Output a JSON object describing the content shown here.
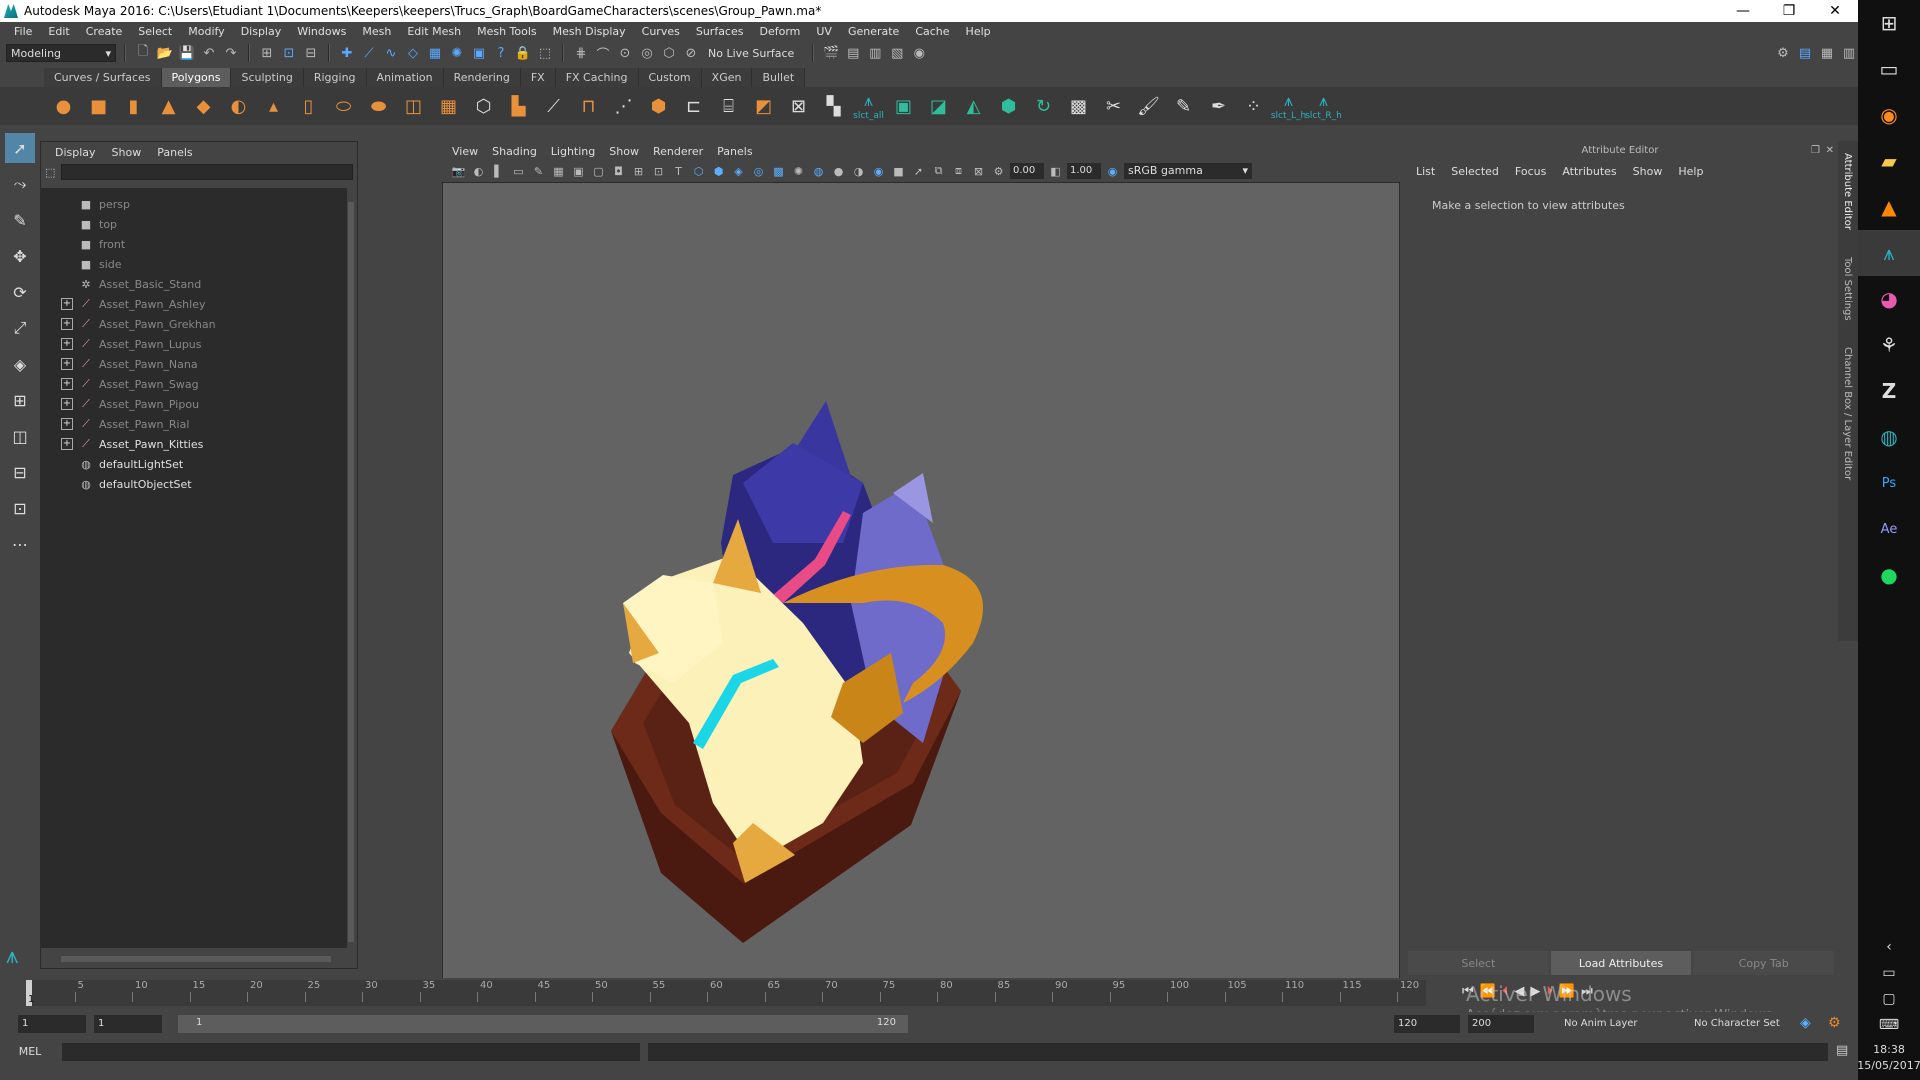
{
  "window": {
    "title": "Autodesk Maya 2016: C:\\Users\\Etudiant 1\\Documents\\Keepers\\keepers\\Trucs_Graph\\BoardGameCharacters\\scenes\\Group_Pawn.ma*",
    "minimize": "—",
    "restore": "❐",
    "close": "✕"
  },
  "menubar": [
    "File",
    "Edit",
    "Create",
    "Select",
    "Modify",
    "Display",
    "Windows",
    "Mesh",
    "Edit Mesh",
    "Mesh Tools",
    "Mesh Display",
    "Curves",
    "Surfaces",
    "Deform",
    "UV",
    "Generate",
    "Cache",
    "Help"
  ],
  "statusline": {
    "mode": "Modeling",
    "live_surface": "No Live Surface"
  },
  "shelf": {
    "tabs": [
      "Curves / Surfaces",
      "Polygons",
      "Sculpting",
      "Rigging",
      "Animation",
      "Rendering",
      "FX",
      "FX Caching",
      "Custom",
      "XGen",
      "Bullet"
    ],
    "active_tab": "Polygons",
    "custom_labels": [
      "slct_all",
      "slct_L_h",
      "slct_R_h"
    ]
  },
  "outliner": {
    "menu": [
      "Display",
      "Show",
      "Panels"
    ],
    "items": [
      {
        "label": "persp",
        "icon": "camera-icon",
        "expandable": false,
        "dim": true
      },
      {
        "label": "top",
        "icon": "camera-icon",
        "expandable": false,
        "dim": true
      },
      {
        "label": "front",
        "icon": "camera-icon",
        "expandable": false,
        "dim": true
      },
      {
        "label": "side",
        "icon": "camera-icon",
        "expandable": false,
        "dim": true
      },
      {
        "label": "Asset_Basic_Stand",
        "icon": "group-icon",
        "expandable": false,
        "dim": true
      },
      {
        "label": "Asset_Pawn_Ashley",
        "icon": "mesh-icon",
        "expandable": true,
        "dim": true
      },
      {
        "label": "Asset_Pawn_Grekhan",
        "icon": "mesh-icon",
        "expandable": true,
        "dim": true
      },
      {
        "label": "Asset_Pawn_Lupus",
        "icon": "mesh-icon",
        "expandable": true,
        "dim": true
      },
      {
        "label": "Asset_Pawn_Nana",
        "icon": "mesh-icon",
        "expandable": true,
        "dim": true
      },
      {
        "label": "Asset_Pawn_Swag",
        "icon": "mesh-icon",
        "expandable": true,
        "dim": true
      },
      {
        "label": "Asset_Pawn_Pipou",
        "icon": "mesh-icon",
        "expandable": true,
        "dim": true
      },
      {
        "label": "Asset_Pawn_Rial",
        "icon": "mesh-icon",
        "expandable": true,
        "dim": true
      },
      {
        "label": "Asset_Pawn_Kitties",
        "icon": "mesh-icon",
        "expandable": true,
        "dim": false
      },
      {
        "label": "defaultLightSet",
        "icon": "set-icon",
        "expandable": false,
        "dim": false
      },
      {
        "label": "defaultObjectSet",
        "icon": "set-icon",
        "expandable": false,
        "dim": false
      }
    ]
  },
  "viewport": {
    "menu": [
      "View",
      "Shading",
      "Lighting",
      "Show",
      "Renderer",
      "Panels"
    ],
    "exposure": "0.00",
    "gamma": "1.00",
    "color_space": "sRGB gamma"
  },
  "attribute_editor": {
    "title": "Attribute Editor",
    "menu": [
      "List",
      "Selected",
      "Focus",
      "Attributes",
      "Show",
      "Help"
    ],
    "message": "Make a selection to view attributes",
    "buttons": [
      "Select",
      "Load Attributes",
      "Copy Tab"
    ],
    "side_tabs": [
      "Attribute Editor",
      "Tool Settings",
      "Channel Box / Layer Editor"
    ]
  },
  "timeslider": {
    "ticks": [
      "5",
      "10",
      "15",
      "20",
      "25",
      "30",
      "35",
      "40",
      "45",
      "50",
      "55",
      "60",
      "65",
      "70",
      "75",
      "80",
      "85",
      "90",
      "95",
      "100",
      "105",
      "110",
      "115",
      "120"
    ],
    "current": "1"
  },
  "rangeslider": {
    "start": "1",
    "playback_start": "1",
    "range_left": "1",
    "range_right": "120",
    "playback_end": "120",
    "end": "200",
    "anim_layer": "No Anim Layer",
    "character_set": "No Character Set"
  },
  "cmdline": {
    "label": "MEL"
  },
  "watermark": {
    "line1": "Activer Windows",
    "line2": "Accédez aux paramètres pour activer Windows."
  },
  "taskbar": {
    "time": "18:38",
    "date": "15/05/2017"
  }
}
